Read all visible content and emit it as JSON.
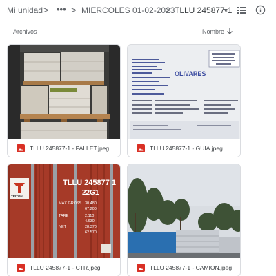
{
  "breadcrumb": {
    "root": "Mi unidad",
    "separator": ">",
    "more": "•••",
    "folder": "MIERCOLES 01-02-2023",
    "current": "TLLU 245877-1"
  },
  "toolbar": {
    "list_view_icon": "list-view-icon",
    "info_icon": "info-icon",
    "caret_icon": "caret-down-icon"
  },
  "section": {
    "label": "Archivos",
    "sort_label": "Nombre",
    "sort_icon": "arrow-down-icon"
  },
  "colors": {
    "image_icon_red": "#d93025",
    "border": "#dadce0",
    "text_muted": "#5f6368"
  },
  "files": [
    {
      "name": "TLLU 245877-1 - PALLET.jpeg",
      "type": "image"
    },
    {
      "name": "TLLU 245877-1 - GUIA.jpeg",
      "type": "image"
    },
    {
      "name": "TLLU 245877-1 - CTR.jpeg",
      "type": "image"
    },
    {
      "name": "TLLU 245877-1 - CAMION.jpeg",
      "type": "image"
    }
  ],
  "thumbnails": {
    "guia": {
      "company": "OLIVARES"
    },
    "ctr": {
      "container_code": "TLLU 245877 1",
      "iso_code": "22G1",
      "brand": "TRITON",
      "max_gross": "30.480",
      "max_gross_lb": "67.200",
      "tare": "2.110",
      "tare_lb": "4.630",
      "net": "28.370",
      "net_lb": "62.570"
    }
  }
}
